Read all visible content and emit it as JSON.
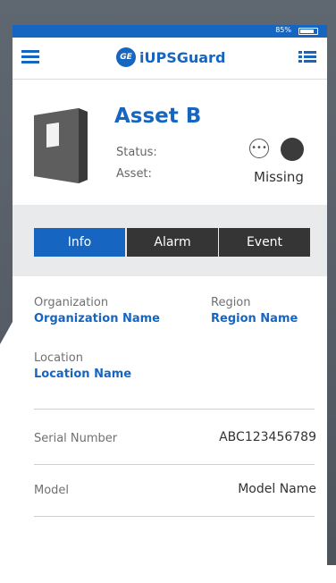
{
  "status_bar": {
    "battery": "85%",
    "battery_level": 0.85
  },
  "app_bar": {
    "brand_logo": "GE",
    "brand_name": "iUPSGuard",
    "menu_icon": "hamburger-icon",
    "list_icon": "list-icon"
  },
  "asset": {
    "title": "Asset B",
    "status_label": "Status:",
    "asset_label": "Asset:",
    "asset_value": "Missing",
    "status_color": "#3b3b3b"
  },
  "tabs": [
    {
      "label": "Info",
      "active": true
    },
    {
      "label": "Alarm",
      "active": false
    },
    {
      "label": "Event",
      "active": false
    }
  ],
  "details": {
    "organization_label": "Organization",
    "organization_value": "Organization Name",
    "region_label": "Region",
    "region_value": "Region Name",
    "location_label": "Location",
    "location_value": "Location Name",
    "serial_label": "Serial Number",
    "serial_value": "ABC123456789",
    "model_label": "Model",
    "model_value": "Model Name"
  },
  "colors": {
    "accent": "#1666c1",
    "tab_inactive": "#353535"
  }
}
